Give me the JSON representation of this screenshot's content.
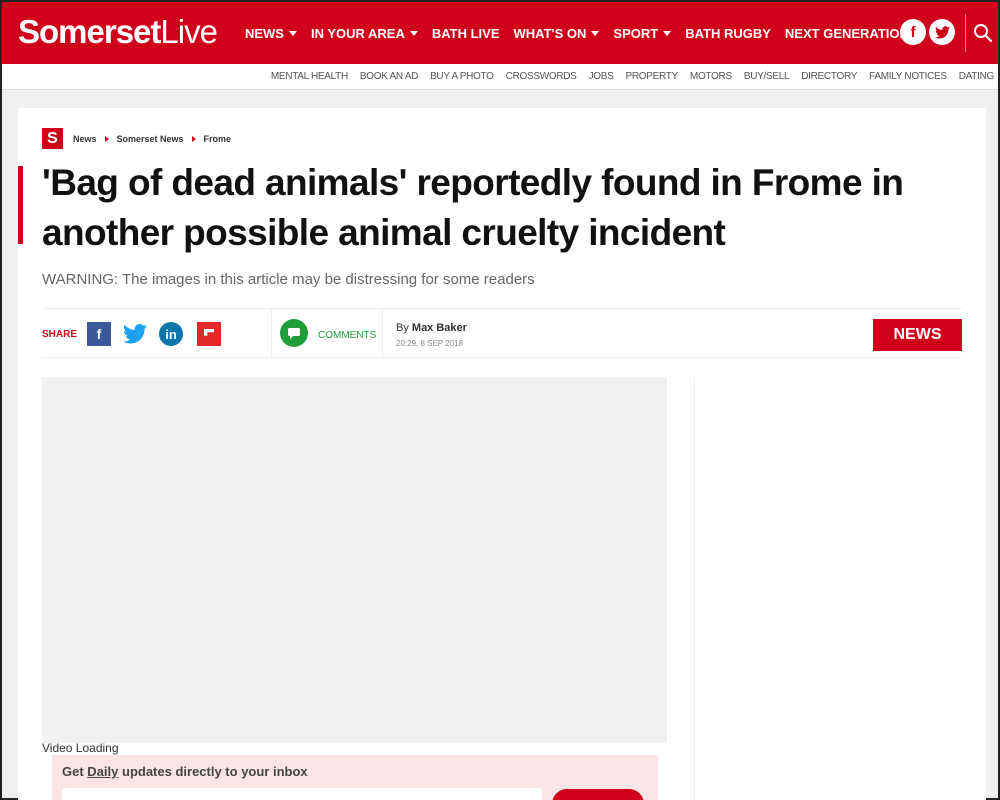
{
  "header": {
    "logo_bold": "Somerset",
    "logo_light": "Live",
    "nav": [
      {
        "label": "NEWS",
        "dropdown": true
      },
      {
        "label": "IN YOUR AREA",
        "dropdown": true
      },
      {
        "label": "BATH LIVE",
        "dropdown": false
      },
      {
        "label": "WHAT'S ON",
        "dropdown": true
      },
      {
        "label": "SPORT",
        "dropdown": true
      },
      {
        "label": "BATH RUGBY",
        "dropdown": false
      },
      {
        "label": "NEXT GENERATION",
        "dropdown": false
      }
    ],
    "social": {
      "facebook": "f",
      "twitter": "t"
    },
    "brand_color": "#d0021b"
  },
  "subnav": [
    "MENTAL HEALTH",
    "BOOK AN AD",
    "BUY A PHOTO",
    "CROSSWORDS",
    "JOBS",
    "PROPERTY",
    "MOTORS",
    "BUY/SELL",
    "DIRECTORY",
    "FAMILY NOTICES",
    "DATING"
  ],
  "breadcrumb": {
    "logo": "S",
    "items": [
      "News",
      "Somerset News",
      "Frome"
    ]
  },
  "article": {
    "headline": "'Bag of dead animals' reportedly found in Frome in another possible animal cruelty incident",
    "warning": "WARNING: The images in this article may be distressing for some readers",
    "share_label": "SHARE",
    "share_icons": {
      "facebook": "f",
      "linkedin": "in"
    },
    "comments_label": "COMMENTS",
    "by_prefix": "By",
    "author": "Max Baker",
    "date": "20:29, 8 SEP 2018",
    "section_badge": "NEWS",
    "video_status": "Video Loading"
  },
  "newsletter": {
    "prefix": "Get",
    "frequency": "Daily",
    "suffix": "updates directly to your inbox"
  }
}
